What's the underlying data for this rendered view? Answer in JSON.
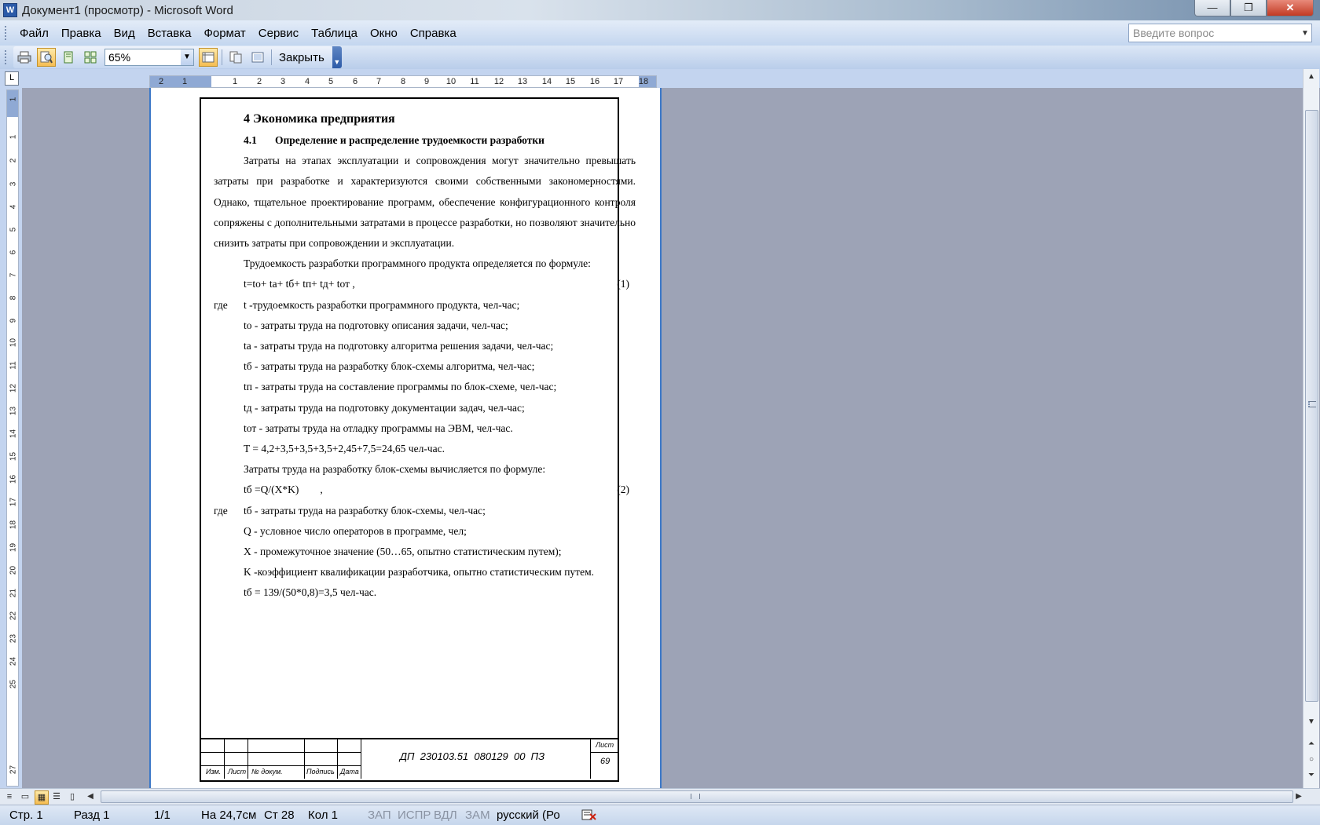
{
  "window": {
    "title": "Документ1 (просмотр) - Microsoft Word",
    "app_icon_glyph": "W",
    "buttons": {
      "minimize": "—",
      "maximize": "❐",
      "close": "✕"
    }
  },
  "menu": {
    "items": [
      "Файл",
      "Правка",
      "Вид",
      "Вставка",
      "Формат",
      "Сервис",
      "Таблица",
      "Окно",
      "Справка"
    ],
    "help_placeholder": "Введите вопрос"
  },
  "toolbar": {
    "icons": [
      "print-icon",
      "magnifier-icon",
      "one-page-icon",
      "multiple-pages-icon",
      "view-ruler-icon",
      "shrink-to-fit-icon",
      "full-screen-icon"
    ],
    "zoom_value": "65%",
    "close_label": "Закрыть"
  },
  "ruler": {
    "h_ticks": [
      "2",
      "1",
      "1",
      "2",
      "3",
      "4",
      "5",
      "6",
      "7",
      "8",
      "9",
      "10",
      "11",
      "12",
      "13",
      "14",
      "15",
      "16",
      "17",
      "18"
    ],
    "v_ticks": [
      "1",
      "1",
      "2",
      "3",
      "4",
      "5",
      "6",
      "7",
      "8",
      "9",
      "10",
      "11",
      "12",
      "13",
      "14",
      "15",
      "16",
      "17",
      "18",
      "19",
      "20",
      "21",
      "22",
      "23",
      "24",
      "25",
      "27"
    ]
  },
  "document": {
    "heading1": "4 Экономика предприятия",
    "heading2_num": "4.1",
    "heading2_text": "Определение и распределение трудоемкости разработки",
    "para1": "Затраты на этапах эксплуатации и сопровождения могут значительно превышать затраты при разработке и характеризуются своими собственными закономерностями. Однако, тщательное проектирование программ, обеспечение конфигурационного контроля сопряжены с дополнительными затратами в процессе разработки, но позволяют значительно снизить затраты при сопровождении и эксплуатации.",
    "para2": "Трудоемкость разработки программного продукта определяется по формуле:",
    "formula1": "t=to+ ta+ tб+ tп+ tд+ tот ,",
    "formula1_num": "(1)",
    "gde_word": "где",
    "def_t": "t -трудоемкость разработки программного продукта, чел-час;",
    "def_to": "to - затраты труда на подготовку описания задачи, чел-час;",
    "def_ta": "ta - затраты труда на подготовку алгоритма решения задачи, чел-час;",
    "def_tb": "tб - затраты труда на разработку блок-схемы алгоритма, чел-час;",
    "def_tp": "tп - затраты труда на составление программы по блок-схеме, чел-час;",
    "def_td": "tд - затраты труда на подготовку документации задач, чел-час;",
    "def_tot": "tот - затраты труда на отладку программы на ЭВМ, чел-час.",
    "calc_T": "T = 4,2+3,5+3,5+3,5+2,45+7,5=24,65 чел-час.",
    "para3": "Затраты труда на разработку блок-схемы вычисляется по формуле:",
    "formula2": "tб =Q/(X*K)        ,",
    "formula2_num": "(2)",
    "def_tb2": "tб - затраты труда на разработку блок-схемы, чел-час;",
    "def_Q": "Q - условное число операторов в программе, чел;",
    "def_X": "X - промежуточное значение (50…65, опытно статистическим путем);",
    "def_K": "K -коэффициент квалификации разработчика, опытно статистическим путем.",
    "calc_tb": "tб = 139/(50*0,8)=3,5 чел-час."
  },
  "stamp": {
    "col_izm": "Изм.",
    "col_list": "Лист",
    "col_doc": "№ докум.",
    "col_sign": "Подпись",
    "col_date": "Дата",
    "code": "ДП  230103.51  080129  00  ПЗ",
    "sheet_label": "Лист",
    "sheet_num": "69"
  },
  "status": {
    "page": "Стр. 1",
    "section": "Разд 1",
    "pages": "1/1",
    "at": "На 24,7см",
    "line": "Ст 28",
    "col": "Кол 1",
    "rec": "ЗАП",
    "trk": "ИСПР",
    "ext": "ВДЛ",
    "ovr": "ЗАМ",
    "lang": "русский (Ро"
  }
}
